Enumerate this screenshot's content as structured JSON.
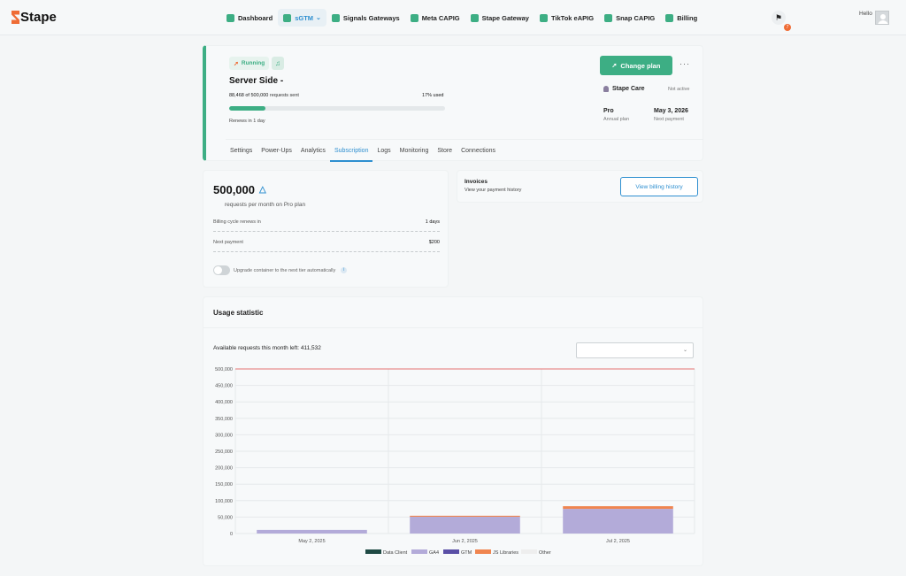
{
  "app": {
    "logo_text": "Stape"
  },
  "nav": [
    {
      "label": "Dashboard",
      "icon": "dashboard-icon",
      "color": "#3dae84",
      "active": false
    },
    {
      "label": "sGTM",
      "icon": "gtm-icon",
      "color": "#3dae84",
      "active": true,
      "dropdown": true
    },
    {
      "label": "Signals Gateways",
      "icon": "signals-icon",
      "color": "#3dae84",
      "active": false
    },
    {
      "label": "Meta CAPIG",
      "icon": "meta-icon",
      "color": "#3dae84",
      "active": false
    },
    {
      "label": "Stape Gateway",
      "icon": "gateway-icon",
      "color": "#3dae84",
      "active": false
    },
    {
      "label": "TikTok eAPIG",
      "icon": "tiktok-icon",
      "color": "#3dae84",
      "active": false
    },
    {
      "label": "Snap CAPIG",
      "icon": "snap-icon",
      "color": "#3dae84",
      "active": false
    },
    {
      "label": "Billing",
      "icon": "billing-icon",
      "color": "#3dae84",
      "active": false
    }
  ],
  "header": {
    "notification_count": "7",
    "hello": "Hello"
  },
  "server": {
    "status": "Running",
    "title": "Server Side -",
    "requests_used": "88,468 of 500,000",
    "requests_suffix": " requests sent",
    "used_percent_label": "17% used",
    "used_fraction": 0.17,
    "renews": "Renews in 1 day",
    "change_plan": "Change plan",
    "more": "···",
    "care_label": "Stape Care",
    "care_status": "Not active",
    "plan_name": "Pro",
    "plan_period": "Annual plan",
    "next_payment_date": "May 3, 2026",
    "next_payment_label": "Next payment"
  },
  "tabs": [
    {
      "label": "Settings",
      "active": false
    },
    {
      "label": "Power-Ups",
      "active": false
    },
    {
      "label": "Analytics",
      "active": false
    },
    {
      "label": "Subscription",
      "active": true
    },
    {
      "label": "Logs",
      "active": false
    },
    {
      "label": "Monitoring",
      "active": false
    },
    {
      "label": "Store",
      "active": false
    },
    {
      "label": "Connections",
      "active": false
    }
  ],
  "subscription": {
    "requests": "500,000",
    "per_month": "requests per month on Pro plan",
    "cycle_label": "Billing cycle renews in",
    "cycle_value": "1 days",
    "next_payment_label": "Next payment",
    "next_payment_value": "$200",
    "upgrade_label": "Upgrade container to the next tier automatically",
    "upgrade_enabled": false
  },
  "invoices": {
    "title": "Invoices",
    "subtitle": "View your payment history",
    "button": "View billing history"
  },
  "usage": {
    "title": "Usage statistic",
    "available": "Available requests this month left: 411,532",
    "select_value": ""
  },
  "chart_data": {
    "type": "bar",
    "stacked": true,
    "categories": [
      "May 2, 2025",
      "Jun 2, 2025",
      "Jul 2, 2025"
    ],
    "series": [
      {
        "name": "Data Client",
        "color": "#1f4a44",
        "values": [
          0,
          0,
          0
        ]
      },
      {
        "name": "GA4",
        "color": "#b3abd9",
        "values": [
          11000,
          51000,
          75000
        ]
      },
      {
        "name": "GTM",
        "color": "#5a4fa6",
        "values": [
          0,
          0,
          0
        ]
      },
      {
        "name": "JS Libraries",
        "color": "#f0854f",
        "values": [
          0,
          3000,
          8000
        ]
      },
      {
        "name": "Other",
        "color": "#eeeeee",
        "values": [
          0,
          0,
          0
        ]
      }
    ],
    "limit": 500000,
    "limit_color": "#e57373",
    "ylim": [
      0,
      500000
    ],
    "yticks": [
      "0",
      "50,000",
      "100,000",
      "150,000",
      "200,000",
      "250,000",
      "300,000",
      "350,000",
      "400,000",
      "450,000",
      "500,000"
    ],
    "grid": true,
    "legend": "bottom"
  }
}
